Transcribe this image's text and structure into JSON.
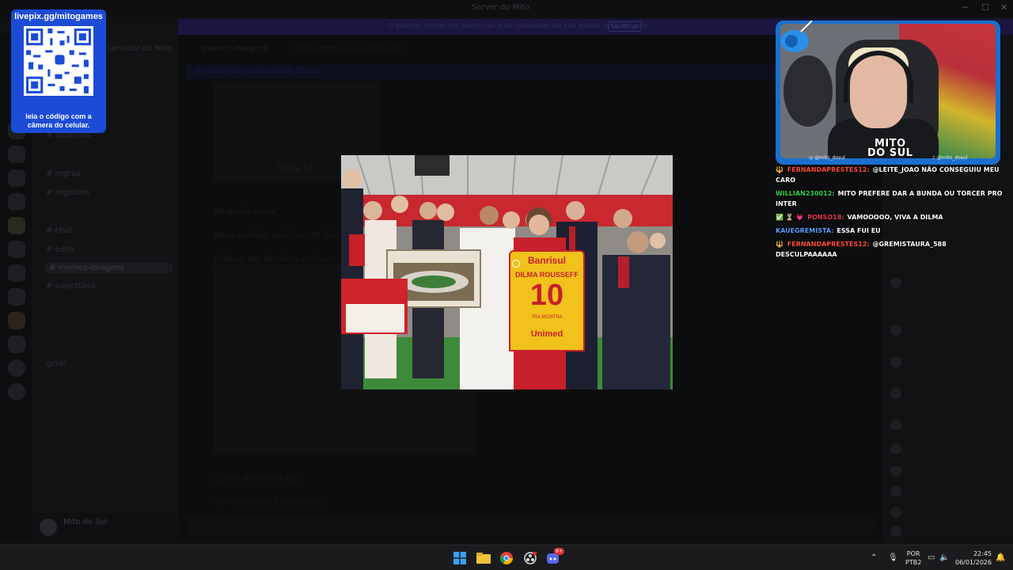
{
  "window": {
    "title": "Server do Mito"
  },
  "banner": {
    "text": "O banner obtido em execução à da faculdade da sua banda está em uso",
    "button": "Verificar"
  },
  "channels": {
    "server_name": "Servidor do Mito",
    "items": [
      {
        "label": "anúncios"
      },
      {
        "label": "regras"
      },
      {
        "label": "registros"
      },
      {
        "label": "chat"
      },
      {
        "label": "edits"
      },
      {
        "label": "memes-imagens"
      },
      {
        "label": "sugestões"
      },
      {
        "label": "geral"
      },
      {
        "label": "Mito do Sul"
      }
    ]
  },
  "main": {
    "channel_name": "memes-imagens",
    "channel_topic": "Mande memes e imagens aqui",
    "new_messages": "30 mensagens novas desde 18:22",
    "poster_caption": "99% fé",
    "msg_line_1": "Ninguém segue",
    "msg_line_2": "Nova redação pela lista 30 dias",
    "msg_line_3": "Foda-se pra jornalista nenhum",
    "msg_line_4": "Cheiro de melhor zap",
    "msg_line_5": "CAMARÃO SAMBO E sem anabolas"
  },
  "qr": {
    "url": "livepix.gg/mitogames",
    "caption_line_1": "leia o código com a",
    "caption_line_2": "câmera do celular."
  },
  "webcam": {
    "brand_line_1": "MITO",
    "brand_line_2": "DO SUL",
    "instagram": "@mito_dosul",
    "tiktok": "@mito_dosul"
  },
  "chat": [
    {
      "badge": "🔱",
      "user": "FERNANDAPRESTES12:",
      "user_color": "#ff4f3a",
      "text": "@LEITE_JOAO NÃO CONSEGUIU MEU CARO"
    },
    {
      "badge": "",
      "user": "WILLIAN230012:",
      "user_color": "#32d24a",
      "text": "MITO PREFERE DAR A BUNDA OU TORCER PRO INTER"
    },
    {
      "badge": "✅ ⏳ 💗",
      "user": "PONSO18:",
      "user_color": "#e23b52",
      "text": "VAMOOOOO, VIVA A DILMA"
    },
    {
      "badge": "",
      "user": "KAUEGREMISTA:",
      "user_color": "#5aa0ff",
      "text": "ESSA FUI EU"
    },
    {
      "badge": "🔱",
      "user": "FERNANDAPRESTES12:",
      "user_color": "#ff4f3a",
      "text": "@GREMISTAURA_588 DESCULPAAAAAA"
    }
  ],
  "photo": {
    "sponsor": "Banrisul",
    "jersey_name": "DILMA ROUSSEFF",
    "jersey_number": "10",
    "jersey_small": "TRA MONTRA",
    "jersey_bottom": "Unimed"
  },
  "taskbar": {
    "lang_1": "POR",
    "lang_2": "PTB2",
    "time": "22:45",
    "date": "06/01/2026",
    "discord_badge": "9+"
  },
  "colors": {
    "qr_blue": "#1c4bd6",
    "cam_border": "#1a6fcf",
    "jersey_yellow": "#f1c21b",
    "jersey_red": "#c8202a"
  }
}
